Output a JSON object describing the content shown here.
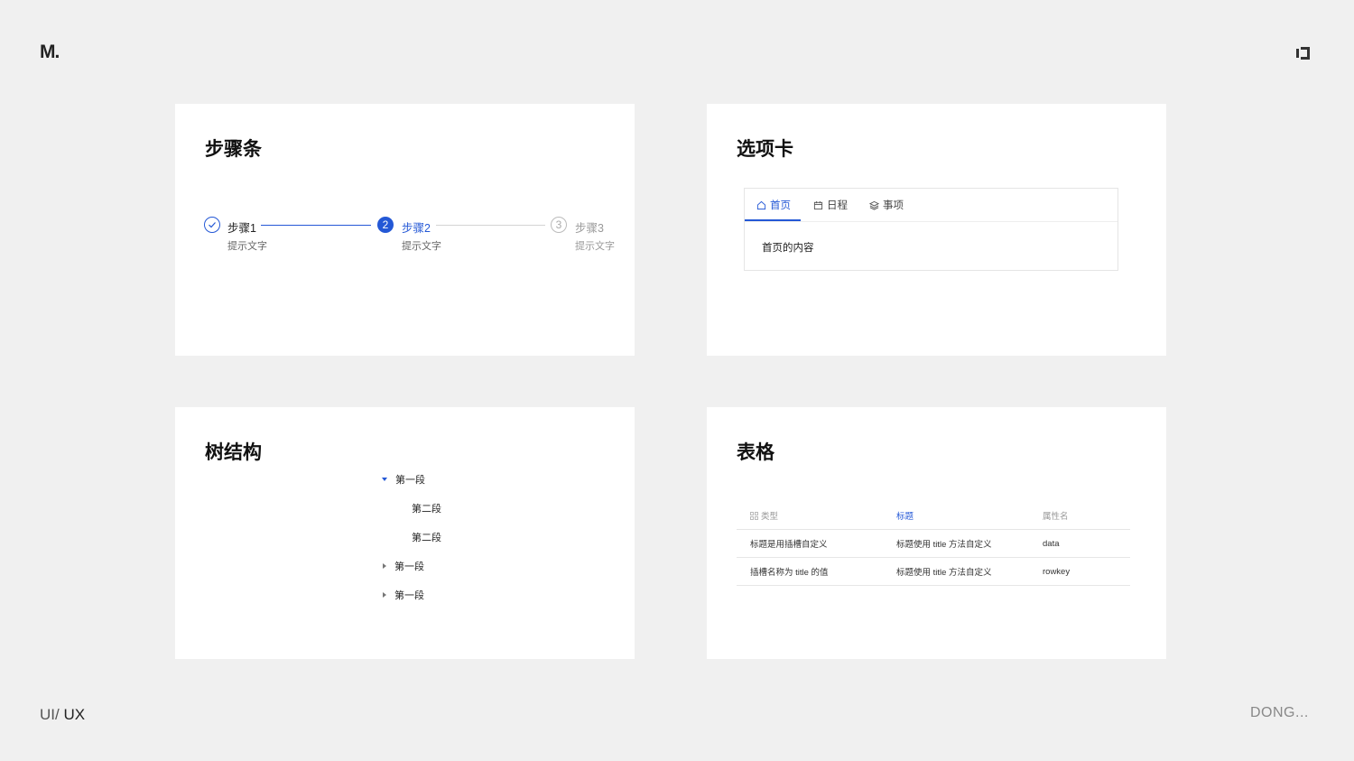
{
  "brand": {
    "logo": "M.",
    "corner_icon": "window-toggle-icon"
  },
  "footer": {
    "left_light": "UI/ ",
    "left_strong": "UX",
    "right": "DONG..."
  },
  "colors": {
    "accent": "#2458d6",
    "background": "#f0f0f0",
    "card": "#ffffff"
  },
  "steps_card": {
    "title": "步骤条",
    "steps": [
      {
        "label": "步骤1",
        "desc": "提示文字",
        "status": "finished",
        "icon": "check-icon"
      },
      {
        "label": "步骤2",
        "desc": "提示文字",
        "status": "active",
        "number": "2"
      },
      {
        "label": "步骤3",
        "desc": "提示文字",
        "status": "waiting",
        "number": "3"
      }
    ]
  },
  "tabs_card": {
    "title": "选项卡",
    "tabs": [
      {
        "label": "首页",
        "icon": "home-icon",
        "active": true
      },
      {
        "label": "日程",
        "icon": "calendar-icon",
        "active": false
      },
      {
        "label": "事项",
        "icon": "layers-icon",
        "active": false
      }
    ],
    "content": "首页的内容"
  },
  "tree_card": {
    "title": "树结构",
    "nodes": [
      {
        "label": "第一段",
        "level": 0,
        "expanded": true
      },
      {
        "label": "第二段",
        "level": 1
      },
      {
        "label": "第二段",
        "level": 1
      },
      {
        "label": "第一段",
        "level": 0,
        "expanded": false
      },
      {
        "label": "第一段",
        "level": 0,
        "expanded": false
      }
    ]
  },
  "table_card": {
    "title": "表格",
    "columns": [
      "类型",
      "标题",
      "属性名"
    ],
    "active_column": 1,
    "rows": [
      [
        "标题是用插槽自定义",
        "标题使用 title 方法自定义",
        "data"
      ],
      [
        "插槽名称为 title 的值",
        "标题使用 title 方法自定义",
        "rowkey"
      ]
    ]
  }
}
